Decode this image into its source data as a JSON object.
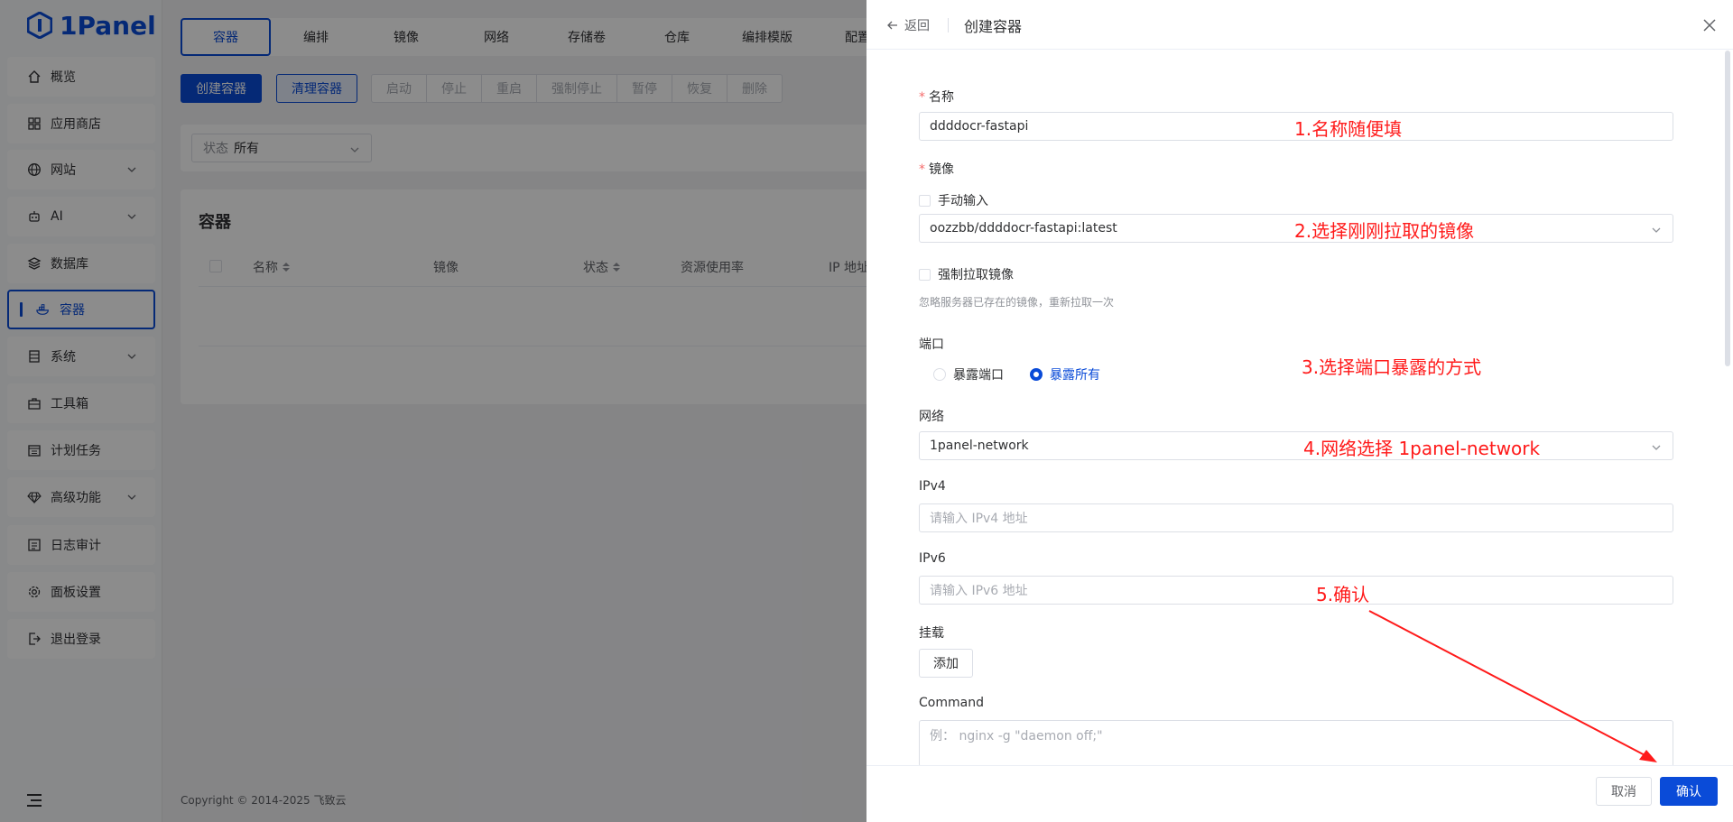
{
  "app": {
    "name": "1Panel"
  },
  "sidebar": {
    "items": [
      {
        "label": "概览",
        "icon": "home-icon"
      },
      {
        "label": "应用商店",
        "icon": "apps-grid-icon"
      },
      {
        "label": "网站",
        "icon": "globe-icon",
        "expandable": true
      },
      {
        "label": "AI",
        "icon": "robot-icon",
        "expandable": true
      },
      {
        "label": "数据库",
        "icon": "database-layers-icon"
      },
      {
        "label": "容器",
        "icon": "docker-whale-icon",
        "active": true
      },
      {
        "label": "系统",
        "icon": "server-icon",
        "expandable": true
      },
      {
        "label": "工具箱",
        "icon": "toolbox-icon"
      },
      {
        "label": "计划任务",
        "icon": "calendar-icon"
      },
      {
        "label": "高级功能",
        "icon": "diamond-icon",
        "expandable": true
      },
      {
        "label": "日志审计",
        "icon": "log-icon"
      },
      {
        "label": "面板设置",
        "icon": "gear-icon"
      },
      {
        "label": "退出登录",
        "icon": "logout-icon"
      }
    ]
  },
  "tabs": [
    "容器",
    "编排",
    "镜像",
    "网络",
    "存储卷",
    "仓库",
    "编排模版",
    "配置"
  ],
  "toolbar": {
    "create": "创建容器",
    "clean": "清理容器",
    "group": [
      "启动",
      "停止",
      "重启",
      "强制停止",
      "暂停",
      "恢复",
      "删除"
    ]
  },
  "filter": {
    "label": "状态",
    "value": "所有"
  },
  "content": {
    "title": "容器",
    "columns": [
      "名称",
      "镜像",
      "状态",
      "资源使用率",
      "IP 地址"
    ]
  },
  "footer": {
    "copyright": "Copyright © 2014-2025 飞致云"
  },
  "drawer": {
    "back": "返回",
    "title": "创建容器",
    "name_label": "名称",
    "name_value": "ddddocr-fastapi",
    "image_label": "镜像",
    "manual_input": "手动输入",
    "image_value": "oozzbb/ddddocr-fastapi:latest",
    "force_pull": "强制拉取镜像",
    "force_pull_hint": "忽略服务器已存在的镜像，重新拉取一次",
    "port_label": "端口",
    "port_options": [
      "暴露端口",
      "暴露所有"
    ],
    "network_label": "网络",
    "network_value": "1panel-network",
    "ipv4_label": "IPv4",
    "ipv4_placeholder": "请输入 IPv4 地址",
    "ipv6_label": "IPv6",
    "ipv6_placeholder": "请输入 IPv6 地址",
    "mount_label": "挂载",
    "add_button": "添加",
    "command_label": "Command",
    "command_placeholder": "例： nginx -g \"daemon off;\"",
    "cancel": "取消",
    "confirm": "确认"
  },
  "annotations": {
    "a1": "1.名称随便填",
    "a2": "2.选择刚刚拉取的镜像",
    "a3": "3.选择端口暴露的方式",
    "a4": "4.网络选择 1panel-network",
    "a5": "5.确认",
    "color": "#ff1a1a"
  },
  "colors": {
    "primary": "#0a4bd8",
    "required": "#f56c6c"
  }
}
